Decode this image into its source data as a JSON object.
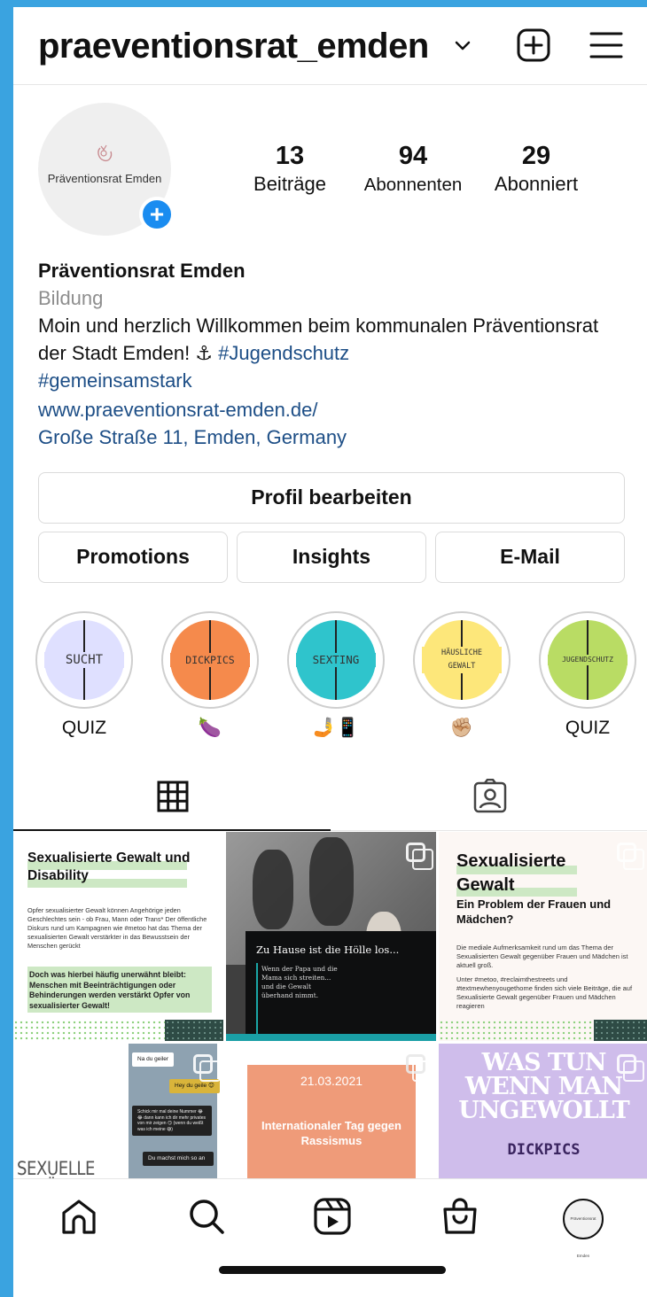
{
  "header": {
    "username": "praeventionsrat_emden"
  },
  "profile": {
    "avatar_text": "Präventionsrat Emden",
    "stats": [
      {
        "value": "13",
        "label": "Beiträge"
      },
      {
        "value": "94",
        "label": "Abonnenten"
      },
      {
        "value": "29",
        "label": "Abonniert"
      }
    ],
    "display_name": "Präventionsrat Emden",
    "category": "Bildung",
    "bio_text": "Moin und herzlich Willkommen beim kommunalen Präventionsrat der Stadt Emden! ⚓ ",
    "hashtag1": "#Jugendschutz",
    "hashtag2": "#gemeinsamstark",
    "website": "www.praeventionsrat-emden.de/",
    "address": "Große Straße 11, Emden, Germany"
  },
  "buttons": {
    "edit_profile": "Profil bearbeiten",
    "promotions": "Promotions",
    "insights": "Insights",
    "email": "E-Mail"
  },
  "highlights": [
    {
      "title": "SUCHT",
      "caption": "QUIZ",
      "color": "#dfe0ff"
    },
    {
      "title": "DICKPICS",
      "caption": "🍆",
      "color": "#f58a4c"
    },
    {
      "title": "SEXTING",
      "caption": "🤳📱",
      "color": "#2fc4cc"
    },
    {
      "title": "HÄUSLICHE GEWALT",
      "title_l1": "HÄUSLICHE",
      "title_l2": "GEWALT",
      "caption": "✊🏼",
      "color": "#fde77a"
    },
    {
      "title": "JUGENDSCHUTZ",
      "caption": "QUIZ",
      "color": "#b9dc64"
    }
  ],
  "posts": {
    "p1": {
      "title": "Sexualisierte Gewalt und Disability",
      "body": "Opfer sexualisierter Gewalt können Angehörige jeden Geschlechtes sein - ob Frau, Mann oder Trans* Der öffentliche Diskurs rund um Kampagnen wie #metoo hat das Thema der sexualisierten Gewalt verstärkter in das Bewusstsein der Menschen gerückt",
      "highlight": "Doch was hierbei häufig unerwähnt bleibt: Menschen mit Beeinträchtigungen oder Behinderungen werden verstärkt Opfer von sexualisierter Gewalt!"
    },
    "p2": {
      "title": "Zu Hause ist die Hölle los...",
      "sub": "Wenn der Papa und die Mama sich streiten... und die Gewalt überhand nimmt."
    },
    "p3": {
      "title": "Sexualisierte Gewalt",
      "sub": "Ein Problem der Frauen und Mädchen?",
      "body1": "Die mediale Aufmerksamkeit rund um das Thema der Sexualisierten Gewalt gegenüber Frauen und Mädchen ist aktuell groß.",
      "body2": "Unter #metoo, #reclaimthestreets und #textmewhenyougethome finden sich viele Beiträge, die auf Sexualisierte Gewalt gegenüber Frauen und Mädchen reagieren"
    },
    "p4": {
      "m1": "Na du geiler",
      "m2": "Hey du geile 😊",
      "m3": "Schick mir mal deine Nummer 😂😂 dann kann ich dir mehr privates von mir zeigen 😏 (wenn du weißt was ich meine 😅)",
      "m4": "Du machst mich so an",
      "big": "SEXUELLE BELÄSTIGUNG IM NETZ"
    },
    "p5": {
      "date": "21.03.2021",
      "title": "Internationaler Tag gegen Rassismus"
    },
    "p6": {
      "title": "WAS TUN WENN MAN UNGEWOLLT",
      "sub": "DICKPICS"
    }
  },
  "nav": {
    "profile_avatar_text": "Präventionsrat Emden"
  },
  "colors": {
    "link": "#1d4e86",
    "accent": "#1a8cf0"
  }
}
